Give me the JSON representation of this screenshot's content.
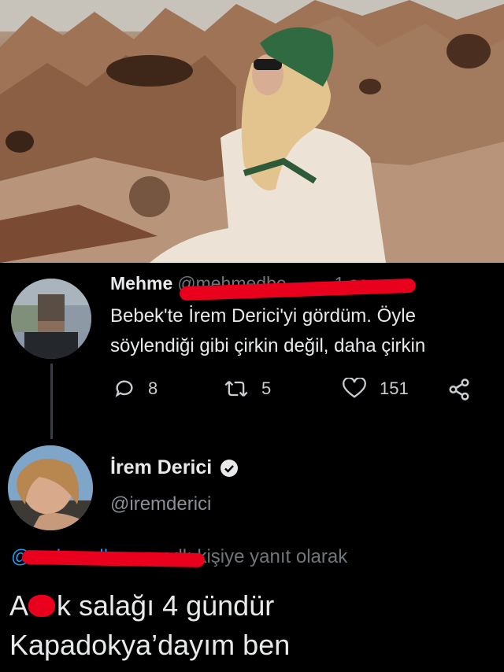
{
  "photo": {
    "description_icon": "landscape-photo"
  },
  "original_tweet": {
    "display_name": "Mehme",
    "handle": "@mehmedbe...",
    "separator": "·",
    "time": "1 sa",
    "text_line1": "Bebek'te İrem Derici'yi gördüm. Öyle",
    "text_line2": "söylendiği gibi çirkin değil, daha çirkin",
    "replies": "8",
    "retweets": "5",
    "likes": "151"
  },
  "reply": {
    "display_name": "İrem Derici",
    "handle": "@iremderici",
    "reply_to_handle": "@mehmedbe...m",
    "reply_to_suffix": "adlı kişiye yanıt olarak",
    "body_line1_start": "A",
    "body_line1_rest": "k salağı 4 gündür",
    "body_line2": "Kapadokya’dayım ben"
  },
  "colors": {
    "background": "#000000",
    "redaction": "#e8001c",
    "link": "#1d9bf0",
    "secondary_text": "#71767b"
  }
}
